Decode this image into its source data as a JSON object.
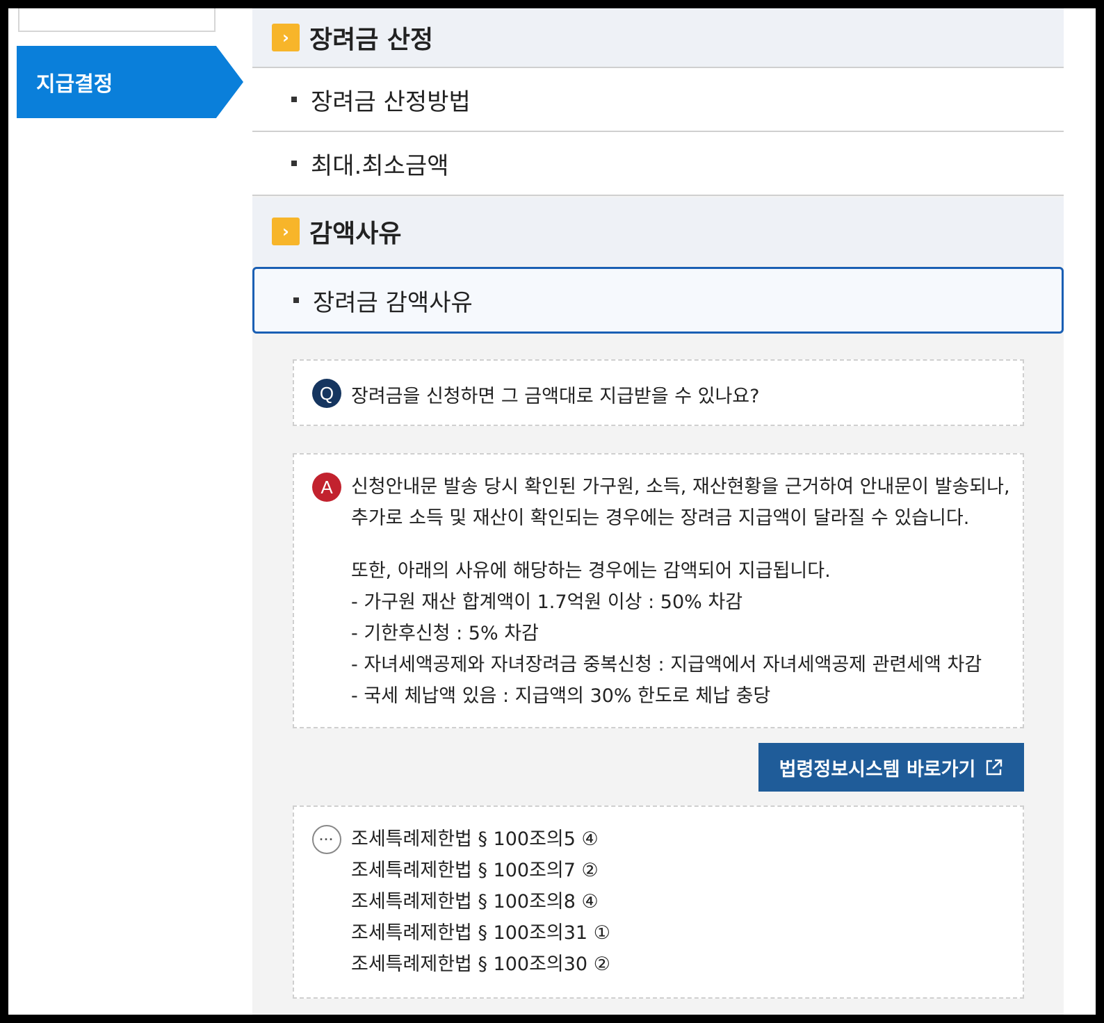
{
  "sidebar": {
    "active_item": "지급결정"
  },
  "sections": [
    {
      "title": "장려금 산정",
      "items": [
        "장려금 산정방법",
        "최대.최소금액"
      ]
    },
    {
      "title": "감액사유",
      "items": [
        "장려금 감액사유"
      ]
    }
  ],
  "qa": {
    "q_badge": "Q",
    "question": "장려금을 신청하면 그 금액대로 지급받을 수 있나요?",
    "a_badge": "A",
    "answer_lines": [
      "신청안내문 발송 당시 확인된 가구원, 소득, 재산현황을 근거하여 안내문이 발송되나,",
      "추가로 소득  및 재산이 확인되는 경우에는 장려금 지급액이 달라질 수 있습니다."
    ],
    "answer_more": [
      "또한, 아래의 사유에 해당하는 경우에는 감액되어 지급됩니다.",
      "- 가구원 재산 합계액이 1.7억원 이상 : 50% 차감",
      "- 기한후신청 : 5% 차감",
      "- 자녀세액공제와 자녀장려금 중복신청 : 지급액에서 자녀세액공제 관련세액 차감",
      "- 국세 체납액 있음 : 지급액의 30% 한도로 체납 충당"
    ]
  },
  "law_button": {
    "label": "법령정보시스템 바로가기",
    "icon": "external-link-icon"
  },
  "references": {
    "icon": "more-icon",
    "badge_text": "···",
    "items": [
      "조세특례제한법 § 100조의5 ④",
      "조세특례제한법 § 100조의7 ②",
      "조세특례제한법 § 100조의8 ④",
      "조세특례제한법 § 100조의31 ①",
      "조세특례제한법 § 100조의30 ②"
    ]
  },
  "colors": {
    "sidebar_active": "#0a7fda",
    "chevron": "#f7b52a",
    "active_border": "#1a5fb4",
    "q_badge": "#15355f",
    "a_badge": "#c2222e",
    "law_button": "#1f5c99"
  }
}
